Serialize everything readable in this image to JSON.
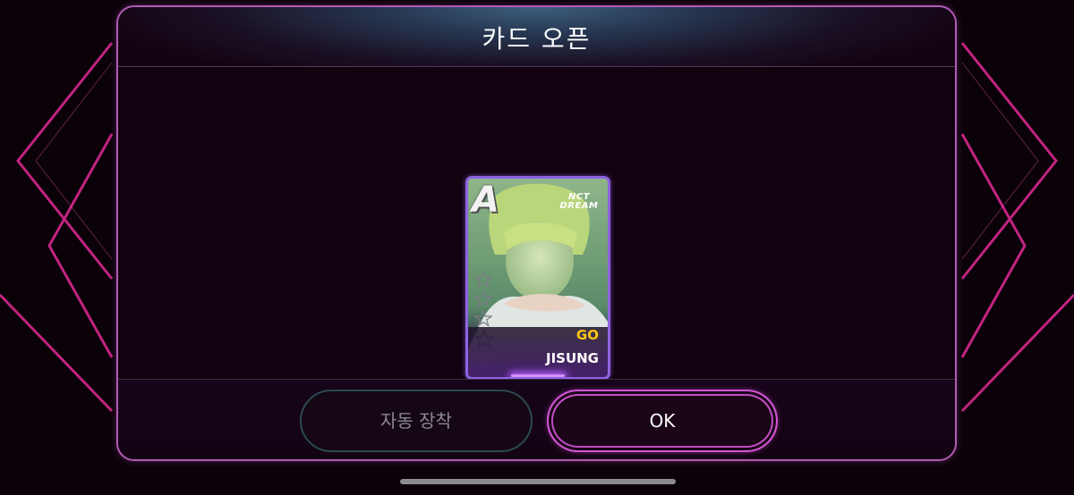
{
  "dialog": {
    "title": "카드 오픈"
  },
  "card": {
    "rank": "A",
    "group_logo": "NCT\nDREAM",
    "group_name": "GO",
    "member_name": "JISUNG",
    "star_count": 5,
    "filled_stars": 1
  },
  "buttons": {
    "auto_equip_label": "자동 장착",
    "ok_label": "OK"
  },
  "colors": {
    "accent_pink": "#d255d5",
    "card_border": "#8d64e0",
    "group_gold": "#ffc515"
  }
}
